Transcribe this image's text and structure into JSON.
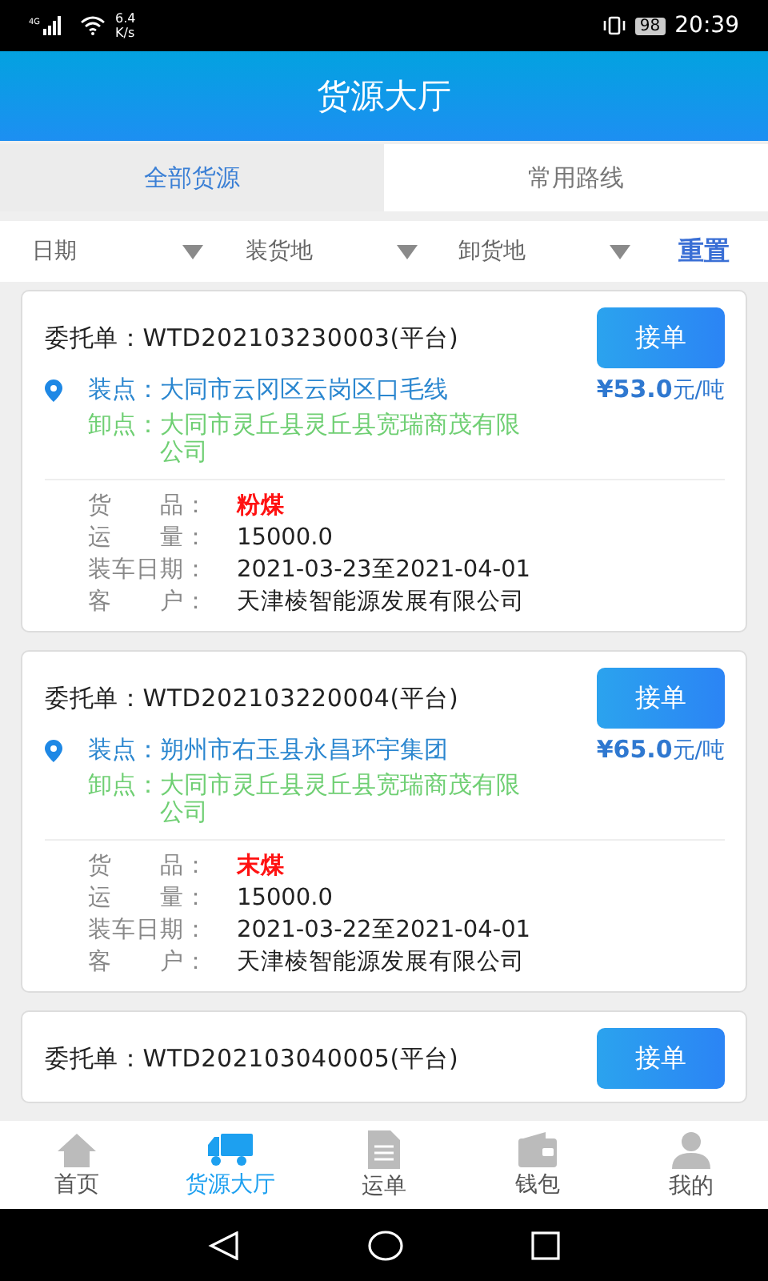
{
  "status_bar": {
    "network": "4G",
    "speed": [
      "6.4",
      "K/s"
    ],
    "battery": "98",
    "time": "20:39"
  },
  "header": {
    "title": "货源大厅"
  },
  "tabs": [
    {
      "label": "全部货源",
      "selected": true
    },
    {
      "label": "常用路线",
      "selected": false
    }
  ],
  "filters": [
    {
      "label": "日期"
    },
    {
      "label": "装货地"
    },
    {
      "label": "卸货地"
    }
  ],
  "reset": "重置",
  "orders": [
    {
      "label": "委托单：",
      "number": "WTD202103230003(平台)",
      "action": "接单",
      "load_label": "装点：",
      "load": "大同市云冈区云岗区口毛线",
      "price": "¥53.0",
      "unit": "元/吨",
      "unload_label": "卸点：",
      "unload": "大同市灵丘县灵丘县宽瑞商茂有限公司",
      "details": [
        {
          "label": "货　　品：",
          "value": "粉煤",
          "kind": "highlight"
        },
        {
          "label": "运　　量：",
          "value": "15000.0",
          "kind": "plain"
        },
        {
          "label": "装车日期：",
          "value": "2021-03-23至2021-04-01",
          "kind": "plain"
        },
        {
          "label": "客　　户：",
          "value": "天津棱智能源发展有限公司",
          "kind": "plain"
        }
      ]
    },
    {
      "label": "委托单：",
      "number": "WTD202103220004(平台)",
      "action": "接单",
      "load_label": "装点：",
      "load": "朔州市右玉县永昌环宇集团",
      "price": "¥65.0",
      "unit": "元/吨",
      "unload_label": "卸点：",
      "unload": "大同市灵丘县灵丘县宽瑞商茂有限公司",
      "details": [
        {
          "label": "货　　品：",
          "value": "末煤",
          "kind": "highlight"
        },
        {
          "label": "运　　量：",
          "value": "15000.0",
          "kind": "plain"
        },
        {
          "label": "装车日期：",
          "value": "2021-03-22至2021-04-01",
          "kind": "plain"
        },
        {
          "label": "客　　户：",
          "value": "天津棱智能源发展有限公司",
          "kind": "plain"
        }
      ]
    },
    {
      "label": "委托单：",
      "number": "WTD202103040005(平台)",
      "action": "接单"
    }
  ],
  "bottom_nav": [
    {
      "label": "首页",
      "kind": "home",
      "selected": false
    },
    {
      "label": "货源大厅",
      "kind": "truck",
      "selected": true
    },
    {
      "label": "运单",
      "kind": "doc",
      "selected": false
    },
    {
      "label": "钱包",
      "kind": "wallet",
      "selected": false
    },
    {
      "label": "我的",
      "kind": "person",
      "selected": false
    }
  ]
}
